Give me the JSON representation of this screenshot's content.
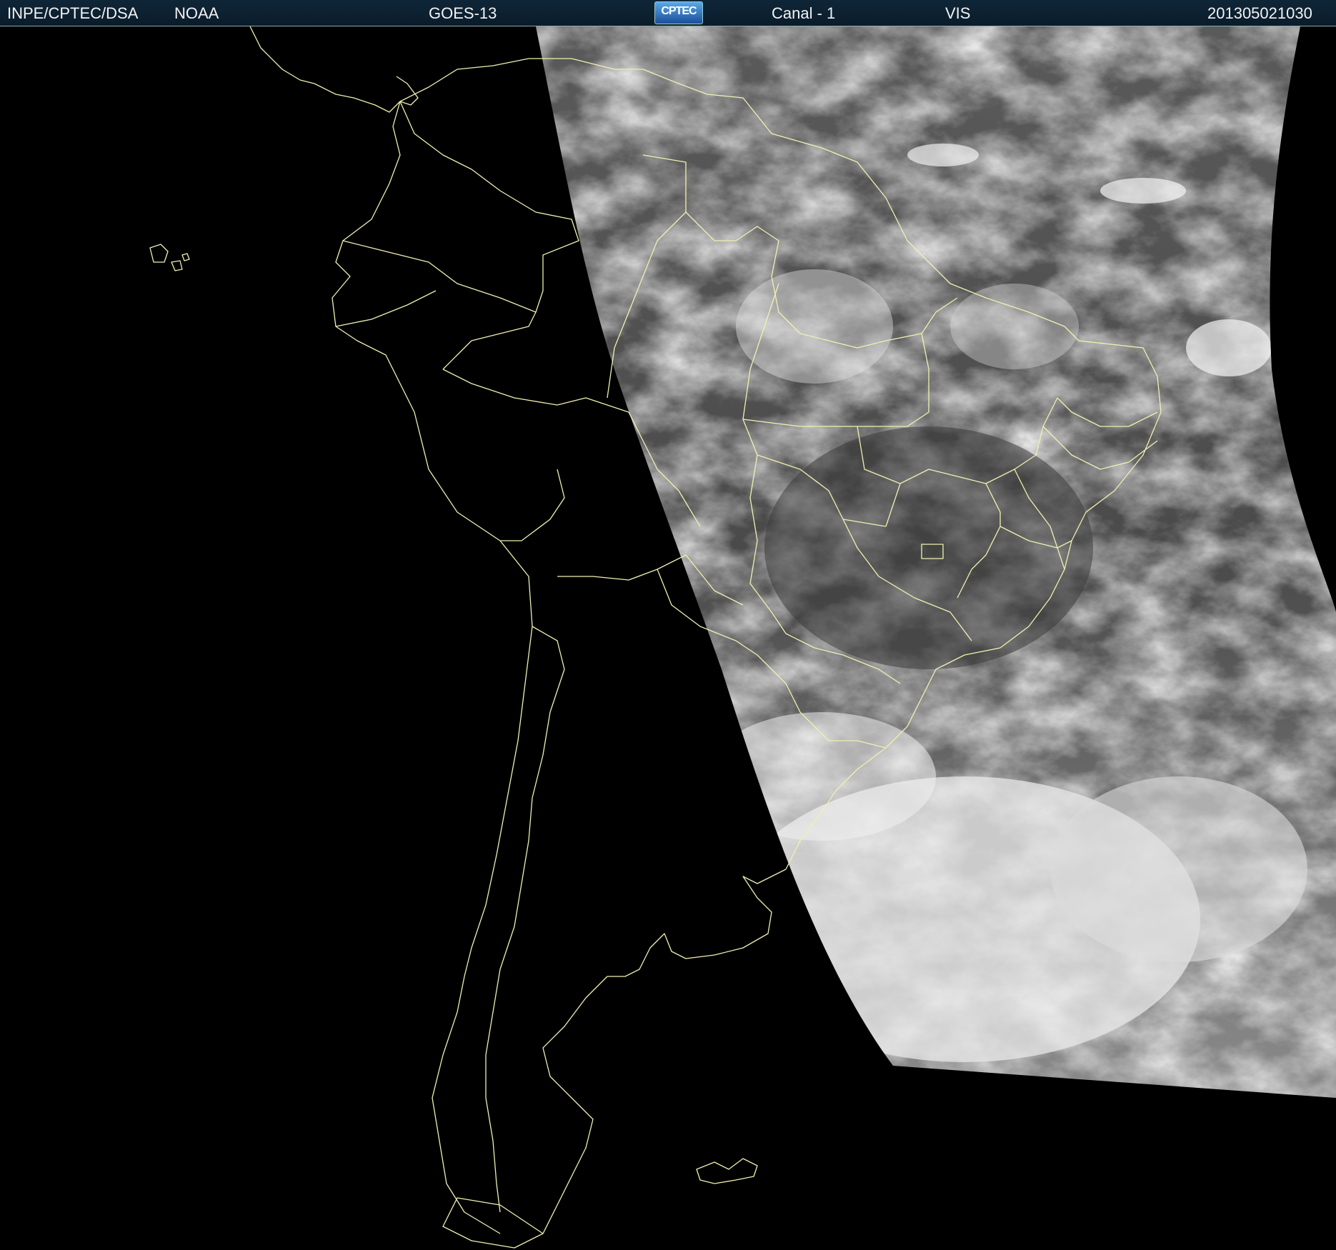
{
  "header": {
    "agency": "INPE/CPTEC/DSA",
    "partner": "NOAA",
    "satellite": "GOES-13",
    "logo_text": "CPTEC",
    "channel": "Canal - 1",
    "band": "VIS",
    "timestamp": "201305021030"
  },
  "colors": {
    "background": "#000000",
    "boundary_lines": "#f0f0b0",
    "header_bg": "#0f2638"
  },
  "map": {
    "region": "South America",
    "imagery": "visible-channel satellite image, grayscale cloud cover on eastern portion"
  }
}
